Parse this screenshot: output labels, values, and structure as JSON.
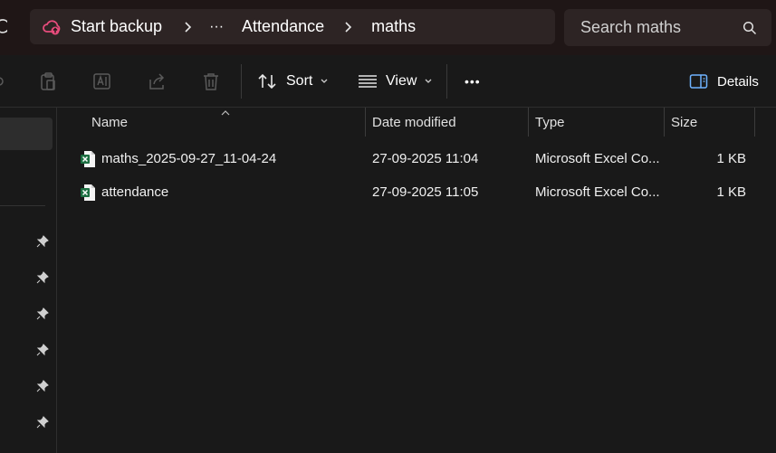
{
  "address_bar": {
    "crumbs": [
      "Start backup",
      "Attendance",
      "maths"
    ],
    "ellipsis": "···"
  },
  "search": {
    "placeholder": "Search maths"
  },
  "command_bar": {
    "sort_label": "Sort",
    "view_label": "View",
    "more_label": "•••",
    "details_label": "Details"
  },
  "file_list": {
    "columns": [
      "Name",
      "Date modified",
      "Type",
      "Size"
    ],
    "rows": [
      {
        "name": "maths_2025-09-27_11-04-24",
        "modified": "27-09-2025 11:04",
        "type": "Microsoft Excel Co...",
        "size": "1 KB",
        "icon": "excel-file-icon"
      },
      {
        "name": "attendance",
        "modified": "27-09-2025 11:05",
        "type": "Microsoft Excel Co...",
        "size": "1 KB",
        "icon": "excel-file-icon"
      }
    ]
  },
  "colors": {
    "background": "#191919",
    "address_bar_bg": "#2d2424",
    "excel_green": "#1d6f42",
    "backup_pink": "#e74c7c"
  }
}
